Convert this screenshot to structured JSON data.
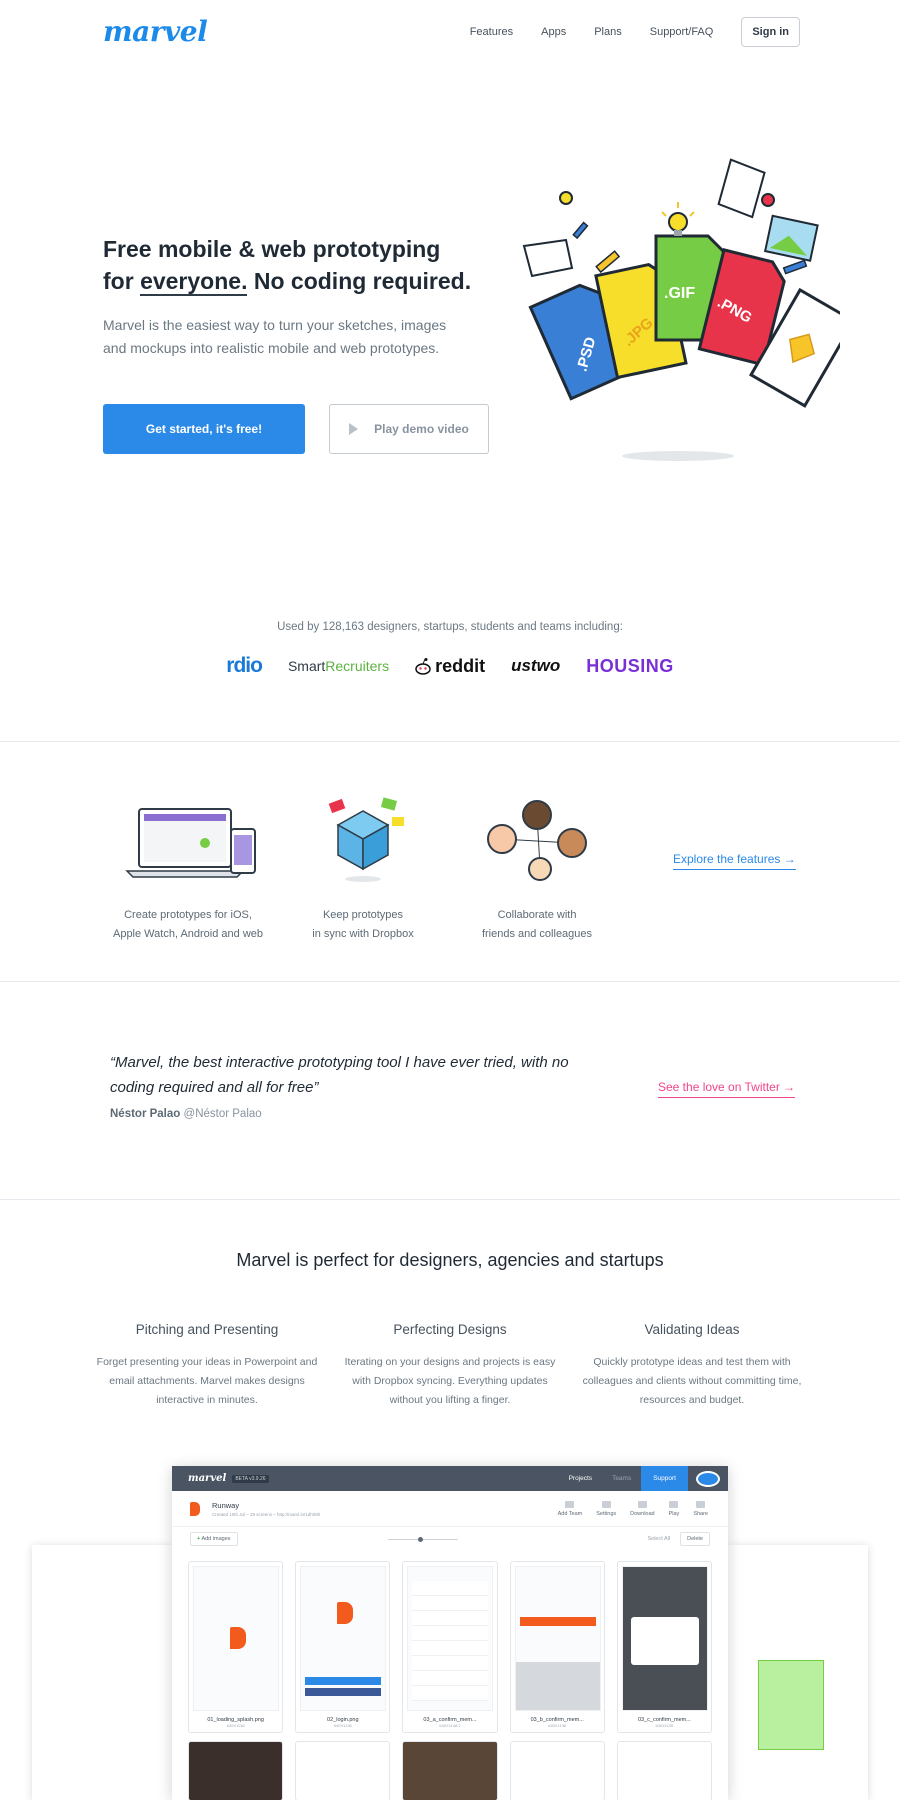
{
  "header": {
    "logo": "marvel",
    "nav": [
      "Features",
      "Apps",
      "Plans",
      "Support/FAQ"
    ],
    "signin": "Sign in"
  },
  "hero": {
    "title_line1": "Free mobile & web prototyping",
    "title_for": "for",
    "title_everyone": "everyone.",
    "title_rest": "No coding required.",
    "description": "Marvel is the easiest way to turn your sketches, images and mockups into realistic mobile and web prototypes.",
    "cta_primary": "Get started, it's free!",
    "cta_demo": "Play demo video",
    "file_labels": [
      ".PSD",
      ".JPG",
      ".GIF",
      ".PNG"
    ]
  },
  "usedby": {
    "text": "Used by 128,163 designers, startups, students and teams including:",
    "brands": [
      "rdio",
      "Smart",
      "Recruiters",
      "reddit",
      "ustwo",
      "HOUSING"
    ]
  },
  "features": {
    "items": [
      {
        "line1": "Create prototypes for iOS,",
        "line2": "Apple Watch, Android and web"
      },
      {
        "line1": "Keep prototypes",
        "line2": "in sync with Dropbox"
      },
      {
        "line1": "Collaborate with",
        "line2": "friends and colleagues"
      }
    ],
    "explore": "Explore the features →"
  },
  "testimonial": {
    "quote": "“Marvel, the best interactive prototyping tool I have ever tried, with no coding required and all for free”",
    "author": "Néstor Palao",
    "handle": "@Néstor Palao",
    "twitter": "See the love on Twitter →"
  },
  "audience": {
    "title": "Marvel is perfect for designers, agencies and startups",
    "columns": [
      {
        "heading": "Pitching and Presenting",
        "text": "Forget presenting your ideas in Powerpoint and email attachments. Marvel makes designs interactive in minutes."
      },
      {
        "heading": "Perfecting Designs",
        "text": "Iterating on your designs and projects is easy with Dropbox syncing. Everything updates without you lifting a finger."
      },
      {
        "heading": "Validating Ideas",
        "text": "Quickly prototype ideas and test them with colleagues and clients without committing time, resources and budget."
      }
    ]
  },
  "app_screenshot": {
    "logo": "marvel",
    "beta": "BETA v3.9.26",
    "nav": [
      "Projects",
      "Teams",
      "Support"
    ],
    "project_name": "Runway",
    "project_sub": "Created 10th Jul – 29 screens – http://marvl.in/1dh09h",
    "actions": [
      "Add Team",
      "Settings",
      "Download",
      "Play",
      "Share"
    ],
    "add_images": "Add images",
    "select_all": "Select All",
    "delete": "Delete",
    "screens": [
      {
        "name": "01_loading_splash.png",
        "size": "640X1136"
      },
      {
        "name": "02_login.png",
        "size": "640X1136"
      },
      {
        "name": "03_a_confirm_mem...",
        "size": "640X1148.2"
      },
      {
        "name": "03_b_confirm_mem...",
        "size": "640X1136"
      },
      {
        "name": "03_c_confirm_mem...",
        "size": "640X1136"
      }
    ]
  }
}
